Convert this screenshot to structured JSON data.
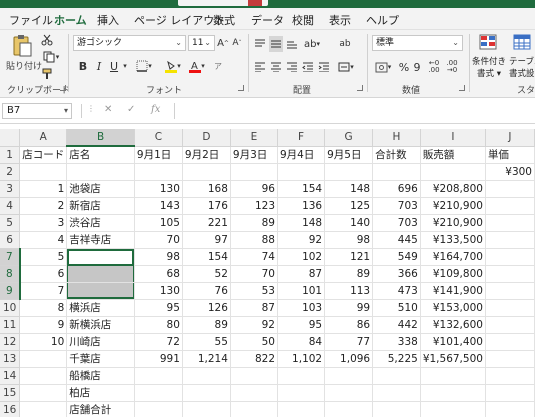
{
  "ribbon_tabs": [
    "ファイル",
    "ホーム",
    "挿入",
    "ページ レイアウト",
    "数式",
    "データ",
    "校閲",
    "表示",
    "ヘルプ"
  ],
  "active_tab": "ホーム",
  "clipboard": {
    "paste_label": "貼り付け",
    "group_label": "クリップボード"
  },
  "font": {
    "name": "游ゴシック",
    "size": "11",
    "group_label": "フォント",
    "bold": "B",
    "italic": "I",
    "underline": "U"
  },
  "alignment": {
    "group_label": "配置"
  },
  "number": {
    "format": "標準",
    "group_label": "数値",
    "percent": "%",
    "comma": "9"
  },
  "styles": {
    "conditional_label": "条件付き",
    "conditional_label2": "書式 ▾",
    "table_label": "テーブル",
    "table_label2": "書式設",
    "group_label": "スタイ"
  },
  "formula_bar": {
    "name_box": "B7",
    "cancel": "✕",
    "enter": "✓",
    "fx": "fx",
    "content": ""
  },
  "columns": [
    "A",
    "B",
    "C",
    "D",
    "E",
    "F",
    "G",
    "H",
    "I",
    "J"
  ],
  "rows": [
    {
      "n": "1",
      "A": "店コード",
      "B": "店名",
      "C": "9月1日",
      "D": "9月2日",
      "E": "9月3日",
      "F": "9月4日",
      "G": "9月5日",
      "H": "合計数",
      "I": "販売額",
      "J": "単価"
    },
    {
      "n": "2",
      "A": "",
      "B": "",
      "C": "",
      "D": "",
      "E": "",
      "F": "",
      "G": "",
      "H": "",
      "I": "",
      "J": "¥300"
    },
    {
      "n": "3",
      "A": "1",
      "B": "池袋店",
      "C": "130",
      "D": "168",
      "E": "96",
      "F": "154",
      "G": "148",
      "H": "696",
      "I": "¥208,800",
      "J": ""
    },
    {
      "n": "4",
      "A": "2",
      "B": "新宿店",
      "C": "143",
      "D": "176",
      "E": "123",
      "F": "136",
      "G": "125",
      "H": "703",
      "I": "¥210,900",
      "J": ""
    },
    {
      "n": "5",
      "A": "3",
      "B": "渋谷店",
      "C": "105",
      "D": "221",
      "E": "89",
      "F": "148",
      "G": "140",
      "H": "703",
      "I": "¥210,900",
      "J": ""
    },
    {
      "n": "6",
      "A": "4",
      "B": "吉祥寺店",
      "C": "70",
      "D": "97",
      "E": "88",
      "F": "92",
      "G": "98",
      "H": "445",
      "I": "¥133,500",
      "J": ""
    },
    {
      "n": "7",
      "A": "5",
      "B": "",
      "C": "98",
      "D": "154",
      "E": "74",
      "F": "102",
      "G": "121",
      "H": "549",
      "I": "¥164,700",
      "J": ""
    },
    {
      "n": "8",
      "A": "6",
      "B": "",
      "C": "68",
      "D": "52",
      "E": "70",
      "F": "87",
      "G": "89",
      "H": "366",
      "I": "¥109,800",
      "J": ""
    },
    {
      "n": "9",
      "A": "7",
      "B": "",
      "C": "130",
      "D": "76",
      "E": "53",
      "F": "101",
      "G": "113",
      "H": "473",
      "I": "¥141,900",
      "J": ""
    },
    {
      "n": "10",
      "A": "8",
      "B": "横浜店",
      "C": "95",
      "D": "126",
      "E": "87",
      "F": "103",
      "G": "99",
      "H": "510",
      "I": "¥153,000",
      "J": ""
    },
    {
      "n": "11",
      "A": "9",
      "B": "新横浜店",
      "C": "80",
      "D": "89",
      "E": "92",
      "F": "95",
      "G": "86",
      "H": "442",
      "I": "¥132,600",
      "J": ""
    },
    {
      "n": "12",
      "A": "10",
      "B": "川崎店",
      "C": "72",
      "D": "55",
      "E": "50",
      "F": "84",
      "G": "77",
      "H": "338",
      "I": "¥101,400",
      "J": ""
    },
    {
      "n": "13",
      "A": "",
      "B": "千葉店",
      "C": "991",
      "D": "1,214",
      "E": "822",
      "F": "1,102",
      "G": "1,096",
      "H": "5,225",
      "I": "¥1,567,500",
      "J": ""
    },
    {
      "n": "14",
      "A": "",
      "B": "船橋店",
      "C": "",
      "D": "",
      "E": "",
      "F": "",
      "G": "",
      "H": "",
      "I": "",
      "J": ""
    },
    {
      "n": "15",
      "A": "",
      "B": "柏店",
      "C": "",
      "D": "",
      "E": "",
      "F": "",
      "G": "",
      "H": "",
      "I": "",
      "J": ""
    },
    {
      "n": "16",
      "A": "",
      "B": "店舗合計",
      "C": "",
      "D": "",
      "E": "",
      "F": "",
      "G": "",
      "H": "",
      "I": "",
      "J": ""
    },
    {
      "n": "17",
      "A": "",
      "B": "",
      "C": "",
      "D": "",
      "E": "",
      "F": "",
      "G": "",
      "H": "",
      "I": "",
      "J": ""
    }
  ],
  "selection": {
    "active": "B7",
    "range": "B7:B9"
  },
  "colors": {
    "accent": "#1f6b3d",
    "selection_fill": "#c6c6c6"
  }
}
